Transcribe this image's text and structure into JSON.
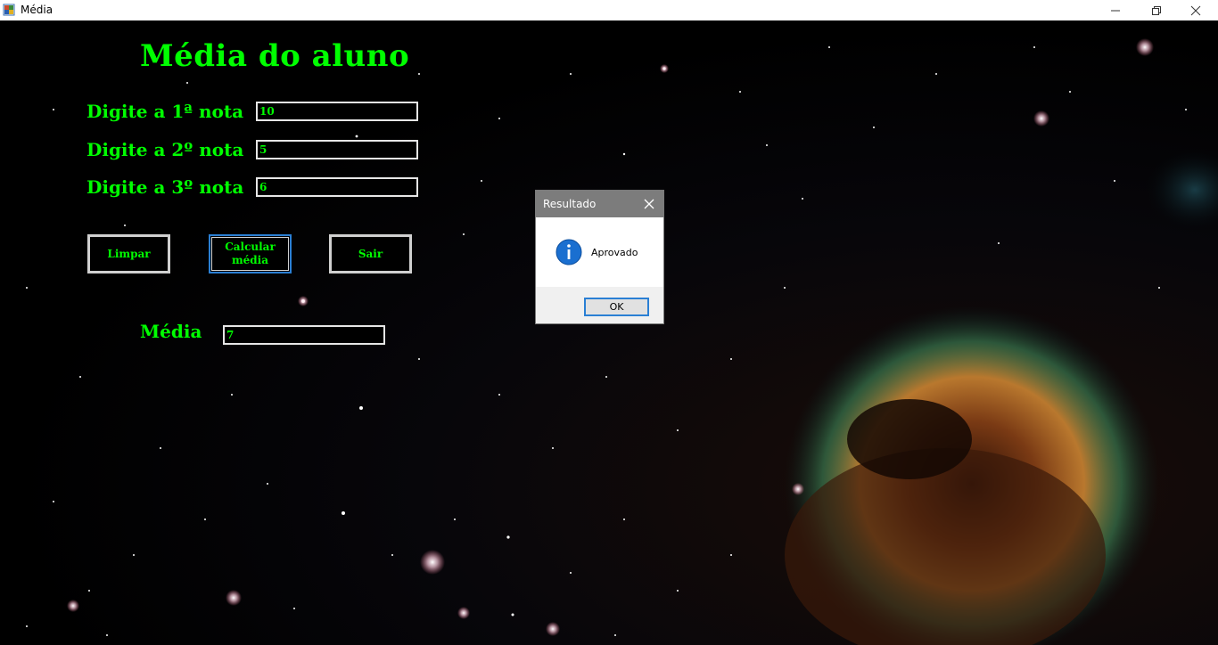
{
  "window": {
    "title": "Média",
    "controls": [
      "minimize-icon",
      "maximize-icon",
      "close-icon"
    ]
  },
  "form": {
    "heading": "Média do aluno",
    "fields": [
      {
        "label": "Digite a 1ª nota",
        "value": "10"
      },
      {
        "label": "Digite a 2º nota",
        "value": "5"
      },
      {
        "label": "Digite a 3º nota",
        "value": "6"
      }
    ],
    "buttons": {
      "clear": "Limpar",
      "calculate_line1": "Calcular",
      "calculate_line2": "média",
      "exit": "Sair"
    },
    "result": {
      "label": "Média",
      "value": "7"
    }
  },
  "dialog": {
    "title": "Resultado",
    "icon": "info-icon",
    "message": "Aprovado",
    "ok_label": "OK"
  },
  "colors": {
    "text": "#00ff00",
    "focus": "#2a7fd4",
    "dialog_title_bg": "#7c7c7c"
  }
}
